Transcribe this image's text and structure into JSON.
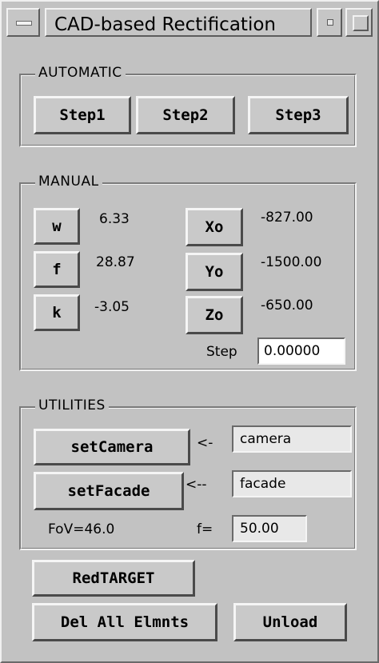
{
  "window": {
    "title": "CAD-based Rectification"
  },
  "automatic": {
    "legend": "AUTOMATIC",
    "step1": "Step1",
    "step2": "Step2",
    "step3": "Step3"
  },
  "manual": {
    "legend": "MANUAL",
    "w": {
      "label": "w",
      "value": "6.33"
    },
    "f": {
      "label": "f",
      "value": "28.87"
    },
    "k": {
      "label": "k",
      "value": "-3.05"
    },
    "xo": {
      "label": "Xo",
      "value": "-827.00"
    },
    "yo": {
      "label": "Yo",
      "value": "-1500.00"
    },
    "zo": {
      "label": "Zo",
      "value": "-650.00"
    },
    "step_label": "Step",
    "step_value": "0.00000"
  },
  "utilities": {
    "legend": "UTILITIES",
    "set_camera": "setCamera",
    "camera_arrow": "<-",
    "camera_value": "camera",
    "set_facade": "setFacade",
    "facade_arrow": "<--",
    "facade_value": "facade",
    "fov": "FoV=46.0",
    "f_label": "f=",
    "f_value": "50.00"
  },
  "bottom": {
    "red_target": "RedTARGET",
    "del_all": "Del All Elmnts",
    "unload": "Unload"
  }
}
